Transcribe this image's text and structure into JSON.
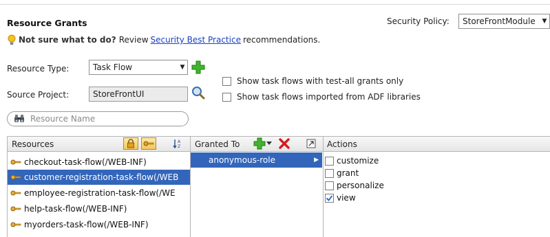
{
  "header": {
    "title": "Resource Grants",
    "policy_label": "Security Policy:",
    "policy_value": "StoreFrontModule"
  },
  "hint": {
    "bold": "Not sure what to do?",
    "pre": "Review",
    "link": "Security Best Practice",
    "post": "recommendations."
  },
  "form": {
    "resource_type_label": "Resource Type:",
    "resource_type_value": "Task Flow",
    "source_project_label": "Source Project:",
    "source_project_value": "StoreFrontUI",
    "show_test_all_label": "Show task flows with test-all grants only",
    "show_imported_label": "Show task flows imported from ADF libraries",
    "resource_search_placeholder": "Resource Name"
  },
  "panels": {
    "resources_header": "Resources",
    "granted_to_header": "Granted To",
    "actions_header": "Actions"
  },
  "resources": [
    {
      "label": "checkout-task-flow(/WEB-INF)",
      "selected": false
    },
    {
      "label": "customer-registration-task-flow(/WEB",
      "selected": true
    },
    {
      "label": "employee-registration-task-flow(/WE",
      "selected": false
    },
    {
      "label": "help-task-flow(/WEB-INF)",
      "selected": false
    },
    {
      "label": "myorders-task-flow(/WEB-INF)",
      "selected": false
    }
  ],
  "granted_to": [
    {
      "label": "anonymous-role",
      "selected": true
    }
  ],
  "actions": [
    {
      "label": "customize",
      "checked": false
    },
    {
      "label": "grant",
      "checked": false
    },
    {
      "label": "personalize",
      "checked": false
    },
    {
      "label": "view",
      "checked": true
    }
  ],
  "colors": {
    "selection": "#3366bb",
    "link": "#1a3fbf",
    "add_green": "#2e9e1f",
    "delete_red": "#d61b1b"
  },
  "icons": {
    "hint": "lightbulb-icon",
    "add_resource_type": "green-plus-icon",
    "source_project_search": "magnifier-icon",
    "resource_search": "binoculars-icon",
    "lock": "lock-icon",
    "key": "key-icon",
    "sort": "sort-az-icon",
    "add_grant": "green-plus-dropdown-icon",
    "delete_grant": "red-x-icon",
    "swap": "swap-panel-icon",
    "resource_item": "key-icon"
  }
}
